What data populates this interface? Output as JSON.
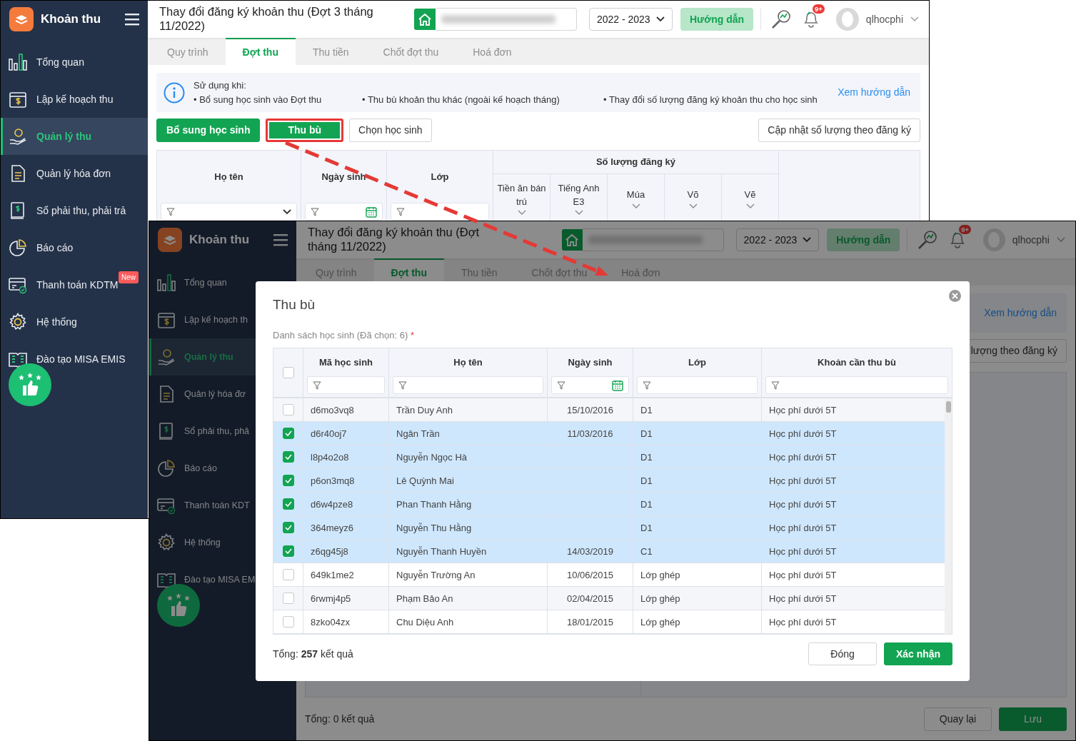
{
  "screen_a": {
    "app_title": "Khoản thu",
    "sidebar": [
      {
        "label": "Tổng quan",
        "selected": false
      },
      {
        "label": "Lập kế hoạch thu",
        "selected": false
      },
      {
        "label": "Quản lý thu",
        "selected": true
      },
      {
        "label": "Quản lý hóa đơn",
        "selected": false
      },
      {
        "label": "Sổ phải thu, phải trả",
        "selected": false
      },
      {
        "label": "Báo cáo",
        "selected": false
      },
      {
        "label": "Thanh toán KDTM",
        "selected": false,
        "badge": "New"
      },
      {
        "label": "Hệ thống",
        "selected": false
      },
      {
        "label": "Đào tạo MISA EMIS",
        "selected": false
      }
    ],
    "header": {
      "title": "Thay đổi đăng ký khoản thu (Đợt 3 tháng 11/2022)",
      "year": "2022 - 2023",
      "guide_button": "Hướng dẫn",
      "notification_count": "9+",
      "username": "qlhocphi"
    },
    "tabs": [
      {
        "label": "Quy trình",
        "selected": false
      },
      {
        "label": "Đợt thu",
        "selected": true
      },
      {
        "label": "Thu tiền",
        "selected": false
      },
      {
        "label": "Chốt đợt thu",
        "selected": false
      },
      {
        "label": "Hoá đơn",
        "selected": false
      }
    ],
    "info": {
      "heading": "Sử dụng khi:",
      "bullets": [
        "• Bổ sung học sinh vào Đợt thu",
        "• Thu bù khoản thu khác (ngoài kế hoạch tháng)",
        "• Thay đổi số lượng đăng ký khoản thu cho học sinh"
      ],
      "link": "Xem hướng dẫn"
    },
    "actions": [
      {
        "label": "Bổ sung học sinh",
        "kind": "primary",
        "highlighted": false
      },
      {
        "label": "Thu bù",
        "kind": "primary",
        "highlighted": true
      },
      {
        "label": "Chọn học sinh",
        "kind": "outline",
        "highlighted": false
      }
    ],
    "update_button": "Cập nhật số lượng theo đăng ký",
    "table": {
      "columns": [
        {
          "label": "Họ tên",
          "kind": "select"
        },
        {
          "label": "Ngày sinh",
          "kind": "date"
        },
        {
          "label": "Lớp",
          "kind": "text"
        }
      ],
      "group": {
        "label": "Số lượng đăng ký",
        "columns": [
          "Tiền ăn bán trú",
          "Tiếng Anh E3",
          "Múa",
          "Võ",
          "Vẽ"
        ]
      }
    }
  },
  "screen_b": {
    "app_title": "Khoản thu",
    "sidebar": [
      {
        "label": "Tổng quan",
        "selected": false
      },
      {
        "label": "Lập kế hoạch th",
        "selected": false
      },
      {
        "label": "Quản lý thu",
        "selected": true
      },
      {
        "label": "Quản lý hóa đơ",
        "selected": false
      },
      {
        "label": "Sổ phải thu, phả",
        "selected": false
      },
      {
        "label": "Báo cáo",
        "selected": false
      },
      {
        "label": "Thanh toán KDT",
        "selected": false
      },
      {
        "label": "Hệ thống",
        "selected": false
      },
      {
        "label": "Đào tạo MISA EM",
        "selected": false
      }
    ],
    "header": {
      "title": [
        "Thay đổi đăng ký khoản thu (Đợt",
        "tháng 11/2022)"
      ],
      "year": "2022 - 2023",
      "guide_button": "Hướng dẫn",
      "notification_count": "9+",
      "username": "qlhocphi"
    },
    "tabs": [
      {
        "label": "Quy trình",
        "selected": false
      },
      {
        "label": "Đợt thu",
        "selected": true
      },
      {
        "label": "Thu tiền",
        "selected": false
      },
      {
        "label": "Chốt đợt thu",
        "selected": false
      },
      {
        "label": "Hoá đơn",
        "selected": false
      }
    ],
    "info_link": "Xem hướng dẫn",
    "update_button": "lượng theo đăng ký",
    "total": "Tổng: 0 kết quả",
    "buttons": [
      {
        "label": "Quay lại",
        "kind": "outline"
      },
      {
        "label": "Lưu",
        "kind": "primary"
      }
    ],
    "modal": {
      "title": "Thu bù",
      "list_label": "Danh sách học sinh (Đã chọn: 6)",
      "required_mark": "*",
      "select_all": false,
      "columns": [
        {
          "label": "Mã học sinh",
          "kind": "text"
        },
        {
          "label": "Họ tên",
          "kind": "text"
        },
        {
          "label": "Ngày sinh",
          "kind": "date"
        },
        {
          "label": "Lớp",
          "kind": "text"
        },
        {
          "label": "Khoản cần thu bù",
          "kind": "text"
        }
      ],
      "rows": [
        {
          "selected": false,
          "cells": [
            "d6mo3vq8",
            "Trần Duy Anh",
            "15/10/2016",
            "D1",
            "Học phí dưới 5T"
          ]
        },
        {
          "selected": true,
          "cells": [
            "d6r40oj7",
            "Ngân Trần",
            "11/03/2016",
            "D1",
            "Học phí dưới 5T"
          ]
        },
        {
          "selected": true,
          "cells": [
            "l8p4o2o8",
            "Nguyễn Ngọc Hà",
            null,
            "D1",
            "Học phí dưới 5T"
          ]
        },
        {
          "selected": true,
          "cells": [
            "p6on3mq8",
            "Lê Quỳnh Mai",
            null,
            "D1",
            "Học phí dưới 5T"
          ]
        },
        {
          "selected": true,
          "cells": [
            "d6w4pze8",
            "Phan Thanh Hằng",
            null,
            "D1",
            "Học phí dưới 5T"
          ]
        },
        {
          "selected": true,
          "cells": [
            "364meyz6",
            "Nguyễn Thu Hằng",
            null,
            "D1",
            "Học phí dưới 5T"
          ]
        },
        {
          "selected": true,
          "cells": [
            "z6qg45j8",
            "Nguyễn Thanh Huyền",
            "14/03/2019",
            "C1",
            "Học phí dưới 5T"
          ]
        },
        {
          "selected": false,
          "cells": [
            "649k1me2",
            "Nguyễn Trường An",
            "10/06/2015",
            "Lớp ghép",
            "Học phí dưới 5T"
          ]
        },
        {
          "selected": false,
          "cells": [
            "6rwmj4p5",
            "Phạm Bảo An",
            "02/04/2015",
            "Lớp ghép",
            "Học phí dưới 5T"
          ]
        },
        {
          "selected": false,
          "cells": [
            "8zko04zx",
            "Chu Diệu Anh",
            "18/01/2015",
            "Lớp ghép",
            "Học phí dưới 5T"
          ]
        }
      ],
      "total": "Tổng: **257** kết quả",
      "buttons": [
        {
          "label": "Đóng",
          "kind": "outline"
        },
        {
          "label": "Xác nhận",
          "kind": "primary"
        }
      ]
    }
  }
}
